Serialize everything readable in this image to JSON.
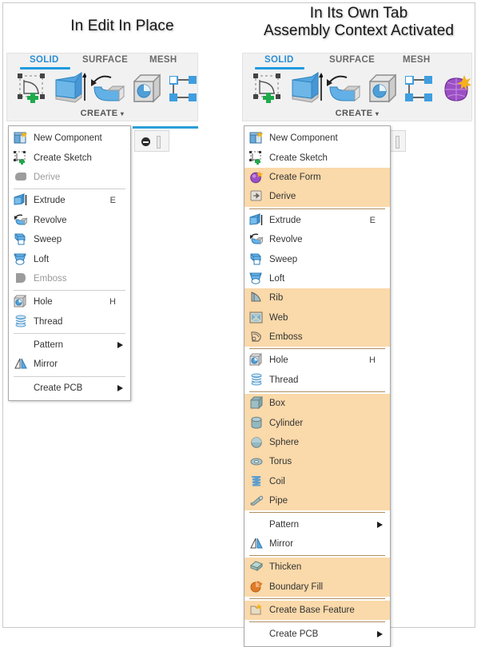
{
  "titles": {
    "left": "In Edit In Place",
    "right": "In Its Own Tab\nAssembly Context Activated"
  },
  "ribbon": {
    "tabs": [
      {
        "label": "SOLID",
        "active": true
      },
      {
        "label": "SURFACE",
        "active": false
      },
      {
        "label": "MESH",
        "active": false
      }
    ],
    "panel_label": "CREATE",
    "panel_caret": "▾",
    "icons_left": [
      "create-sketch-icon",
      "extrude-icon",
      "revolve-icon",
      "hole-icon",
      "pattern-icon"
    ],
    "icons_right": [
      "create-sketch-icon",
      "extrude-icon",
      "revolve-icon",
      "hole-icon",
      "pattern-icon",
      "create-form-icon"
    ]
  },
  "colors": {
    "accent_blue": "#2a9fd8",
    "tab_active": "#2a8ed6",
    "highlight_orange": "#fad9aa",
    "ribbon_bg": "#f1f1f1",
    "menu_bg": "#ffffff",
    "separator": "#cfcfcf"
  },
  "menu_left": {
    "name": "CREATE dropdown - In Edit In Place",
    "items": [
      {
        "label": "New Component",
        "icon": "new-component-icon",
        "disabled": false,
        "highlight": false,
        "shortcut": "",
        "submenu": false
      },
      {
        "label": "Create Sketch",
        "icon": "create-sketch-icon",
        "disabled": false,
        "highlight": false,
        "shortcut": "",
        "submenu": false
      },
      {
        "label": "Derive",
        "icon": "derive-icon",
        "disabled": true,
        "highlight": false,
        "shortcut": "",
        "submenu": false
      },
      {
        "separator": true
      },
      {
        "label": "Extrude",
        "icon": "extrude-icon",
        "disabled": false,
        "highlight": false,
        "shortcut": "E",
        "submenu": false
      },
      {
        "label": "Revolve",
        "icon": "revolve-icon",
        "disabled": false,
        "highlight": false,
        "shortcut": "",
        "submenu": false
      },
      {
        "label": "Sweep",
        "icon": "sweep-icon",
        "disabled": false,
        "highlight": false,
        "shortcut": "",
        "submenu": false
      },
      {
        "label": "Loft",
        "icon": "loft-icon",
        "disabled": false,
        "highlight": false,
        "shortcut": "",
        "submenu": false
      },
      {
        "label": "Emboss",
        "icon": "emboss-icon",
        "disabled": true,
        "highlight": false,
        "shortcut": "",
        "submenu": false
      },
      {
        "separator": true
      },
      {
        "label": "Hole",
        "icon": "hole-icon",
        "disabled": false,
        "highlight": false,
        "shortcut": "H",
        "submenu": false
      },
      {
        "label": "Thread",
        "icon": "thread-icon",
        "disabled": false,
        "highlight": false,
        "shortcut": "",
        "submenu": false
      },
      {
        "separator": true
      },
      {
        "label": "Pattern",
        "icon": "",
        "disabled": false,
        "highlight": false,
        "shortcut": "",
        "submenu": true
      },
      {
        "label": "Mirror",
        "icon": "mirror-icon",
        "disabled": false,
        "highlight": false,
        "shortcut": "",
        "submenu": false
      },
      {
        "separator": true
      },
      {
        "label": "Create PCB",
        "icon": "",
        "disabled": false,
        "highlight": false,
        "shortcut": "",
        "submenu": true
      }
    ]
  },
  "menu_right": {
    "name": "CREATE dropdown - In Its Own Tab",
    "items": [
      {
        "label": "New Component",
        "icon": "new-component-icon",
        "disabled": false,
        "highlight": false,
        "shortcut": "",
        "submenu": false
      },
      {
        "label": "Create Sketch",
        "icon": "create-sketch-icon",
        "disabled": false,
        "highlight": false,
        "shortcut": "",
        "submenu": false
      },
      {
        "label": "Create Form",
        "icon": "create-form-icon",
        "disabled": false,
        "highlight": true,
        "shortcut": "",
        "submenu": false
      },
      {
        "label": "Derive",
        "icon": "derive-icon",
        "disabled": false,
        "highlight": true,
        "shortcut": "",
        "submenu": false
      },
      {
        "separator": true,
        "dark": true
      },
      {
        "label": "Extrude",
        "icon": "extrude-icon",
        "disabled": false,
        "highlight": false,
        "shortcut": "E",
        "submenu": false
      },
      {
        "label": "Revolve",
        "icon": "revolve-icon",
        "disabled": false,
        "highlight": false,
        "shortcut": "",
        "submenu": false
      },
      {
        "label": "Sweep",
        "icon": "sweep-icon",
        "disabled": false,
        "highlight": false,
        "shortcut": "",
        "submenu": false
      },
      {
        "label": "Loft",
        "icon": "loft-icon",
        "disabled": false,
        "highlight": false,
        "shortcut": "",
        "submenu": false
      },
      {
        "label": "Rib",
        "icon": "rib-icon",
        "disabled": false,
        "highlight": true,
        "shortcut": "",
        "submenu": false
      },
      {
        "label": "Web",
        "icon": "web-icon",
        "disabled": false,
        "highlight": true,
        "shortcut": "",
        "submenu": false
      },
      {
        "label": "Emboss",
        "icon": "emboss-icon",
        "disabled": false,
        "highlight": true,
        "shortcut": "",
        "submenu": false
      },
      {
        "separator": true,
        "dark": true
      },
      {
        "label": "Hole",
        "icon": "hole-icon",
        "disabled": false,
        "highlight": false,
        "shortcut": "H",
        "submenu": false
      },
      {
        "label": "Thread",
        "icon": "thread-icon",
        "disabled": false,
        "highlight": false,
        "shortcut": "",
        "submenu": false
      },
      {
        "separator": true,
        "dark": true
      },
      {
        "label": "Box",
        "icon": "box-icon",
        "disabled": false,
        "highlight": true,
        "shortcut": "",
        "submenu": false
      },
      {
        "label": "Cylinder",
        "icon": "cylinder-icon",
        "disabled": false,
        "highlight": true,
        "shortcut": "",
        "submenu": false
      },
      {
        "label": "Sphere",
        "icon": "sphere-icon",
        "disabled": false,
        "highlight": true,
        "shortcut": "",
        "submenu": false
      },
      {
        "label": "Torus",
        "icon": "torus-icon",
        "disabled": false,
        "highlight": true,
        "shortcut": "",
        "submenu": false
      },
      {
        "label": "Coil",
        "icon": "coil-icon",
        "disabled": false,
        "highlight": true,
        "shortcut": "",
        "submenu": false
      },
      {
        "label": "Pipe",
        "icon": "pipe-icon",
        "disabled": false,
        "highlight": true,
        "shortcut": "",
        "submenu": false
      },
      {
        "separator": true,
        "dark": true
      },
      {
        "label": "Pattern",
        "icon": "",
        "disabled": false,
        "highlight": false,
        "shortcut": "",
        "submenu": true
      },
      {
        "label": "Mirror",
        "icon": "mirror-icon",
        "disabled": false,
        "highlight": false,
        "shortcut": "",
        "submenu": false
      },
      {
        "separator": true,
        "dark": true
      },
      {
        "label": "Thicken",
        "icon": "thicken-icon",
        "disabled": false,
        "highlight": true,
        "shortcut": "",
        "submenu": false
      },
      {
        "label": "Boundary Fill",
        "icon": "boundary-fill-icon",
        "disabled": false,
        "highlight": true,
        "shortcut": "",
        "submenu": false
      },
      {
        "separator": true,
        "dark": true
      },
      {
        "label": "Create Base Feature",
        "icon": "create-base-feature-icon",
        "disabled": false,
        "highlight": true,
        "shortcut": "",
        "submenu": false
      },
      {
        "separator": true,
        "dark": true
      },
      {
        "label": "Create PCB",
        "icon": "",
        "disabled": false,
        "highlight": false,
        "shortcut": "",
        "submenu": true
      }
    ]
  }
}
